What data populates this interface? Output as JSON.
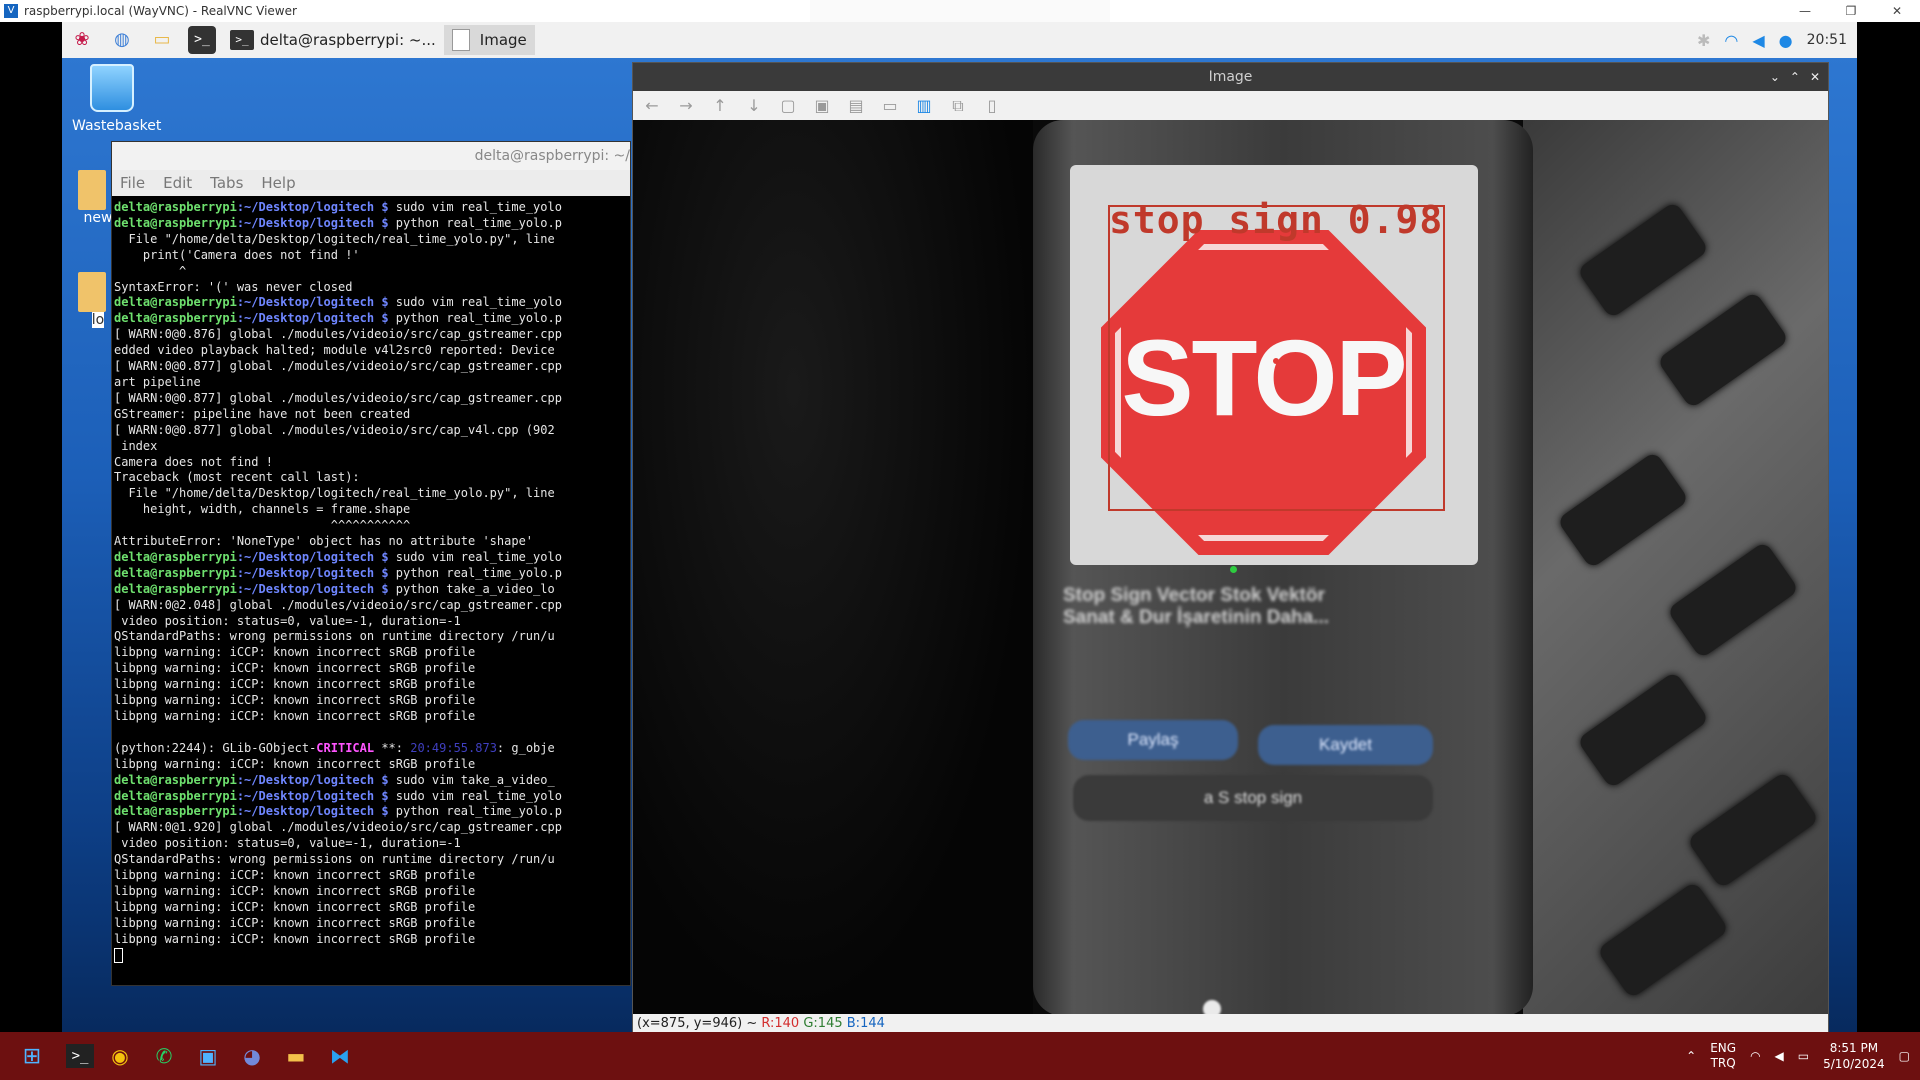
{
  "vnc": {
    "title": "raspberrypi.local (WayVNC) - RealVNC Viewer",
    "icon": "vnc-icon",
    "controls": [
      "—",
      "❐",
      "✕"
    ]
  },
  "pi_panel": {
    "tasks": [
      {
        "label": "delta@raspberrypi: ~..."
      },
      {
        "label": "Image"
      }
    ],
    "clock": "20:51"
  },
  "desktop": {
    "wastebasket": "Wastebasket",
    "folder1_label": "new",
    "folder2_label": "lo"
  },
  "terminal": {
    "title": "delta@raspberrypi: ~/",
    "menu": [
      "File",
      "Edit",
      "Tabs",
      "Help"
    ],
    "lines": [
      {
        "user": "delta@raspberrypi",
        "path": ":~/Desktop/logitech $",
        "cmd": " sudo vim real_time_yolo"
      },
      {
        "user": "delta@raspberrypi",
        "path": ":~/Desktop/logitech $",
        "cmd": " python real_time_yolo.p"
      },
      {
        "text": "  File \"/home/delta/Desktop/logitech/real_time_yolo.py\", line"
      },
      {
        "text": "    print('Camera does not find !'"
      },
      {
        "text": "         ^"
      },
      {
        "text": "SyntaxError: '(' was never closed"
      },
      {
        "user": "delta@raspberrypi",
        "path": ":~/Desktop/logitech $",
        "cmd": " sudo vim real_time_yolo"
      },
      {
        "user": "delta@raspberrypi",
        "path": ":~/Desktop/logitech $",
        "cmd": " python real_time_yolo.p"
      },
      {
        "text": "[ WARN:0@0.876] global ./modules/videoio/src/cap_gstreamer.cpp"
      },
      {
        "text": "edded video playback halted; module v4l2src0 reported: Device"
      },
      {
        "text": "[ WARN:0@0.877] global ./modules/videoio/src/cap_gstreamer.cpp"
      },
      {
        "text": "art pipeline"
      },
      {
        "text": "[ WARN:0@0.877] global ./modules/videoio/src/cap_gstreamer.cpp"
      },
      {
        "text": "GStreamer: pipeline have not been created"
      },
      {
        "text": "[ WARN:0@0.877] global ./modules/videoio/src/cap_v4l.cpp (902"
      },
      {
        "text": " index"
      },
      {
        "text": "Camera does not find !"
      },
      {
        "text": "Traceback (most recent call last):"
      },
      {
        "text": "  File \"/home/delta/Desktop/logitech/real_time_yolo.py\", line"
      },
      {
        "text": "    height, width, channels = frame.shape"
      },
      {
        "text": "                              ^^^^^^^^^^^"
      },
      {
        "text": "AttributeError: 'NoneType' object has no attribute 'shape'"
      },
      {
        "user": "delta@raspberrypi",
        "path": ":~/Desktop/logitech $",
        "cmd": " sudo vim real_time_yolo"
      },
      {
        "user": "delta@raspberrypi",
        "path": ":~/Desktop/logitech $",
        "cmd": " python real_time_yolo.p"
      },
      {
        "user": "delta@raspberrypi",
        "path": ":~/Desktop/logitech $",
        "cmd": " python take_a_video_lo"
      },
      {
        "text": "[ WARN:0@2.048] global ./modules/videoio/src/cap_gstreamer.cpp"
      },
      {
        "text": " video position: status=0, value=-1, duration=-1"
      },
      {
        "text": "QStandardPaths: wrong permissions on runtime directory /run/u"
      },
      {
        "text": "libpng warning: iCCP: known incorrect sRGB profile"
      },
      {
        "text": "libpng warning: iCCP: known incorrect sRGB profile"
      },
      {
        "text": "libpng warning: iCCP: known incorrect sRGB profile"
      },
      {
        "text": "libpng warning: iCCP: known incorrect sRGB profile"
      },
      {
        "text": "libpng warning: iCCP: known incorrect sRGB profile"
      },
      {
        "text": ""
      },
      {
        "crit_pre": "(python:2244): GLib-GObject-",
        "crit": "CRITICAL",
        "crit_mid": " **: ",
        "crit_ts": "20:49:55.873",
        "crit_post": ": g_obje"
      },
      {
        "text": "libpng warning: iCCP: known incorrect sRGB profile"
      },
      {
        "user": "delta@raspberrypi",
        "path": ":~/Desktop/logitech $",
        "cmd": " sudo vim take_a_video_"
      },
      {
        "user": "delta@raspberrypi",
        "path": ":~/Desktop/logitech $",
        "cmd": " sudo vim real_time_yolo"
      },
      {
        "user": "delta@raspberrypi",
        "path": ":~/Desktop/logitech $",
        "cmd": " python real_time_yolo.p"
      },
      {
        "text": "[ WARN:0@1.920] global ./modules/videoio/src/cap_gstreamer.cpp"
      },
      {
        "text": " video position: status=0, value=-1, duration=-1"
      },
      {
        "text": "QStandardPaths: wrong permissions on runtime directory /run/u"
      },
      {
        "text": "libpng warning: iCCP: known incorrect sRGB profile"
      },
      {
        "text": "libpng warning: iCCP: known incorrect sRGB profile"
      },
      {
        "text": "libpng warning: iCCP: known incorrect sRGB profile"
      },
      {
        "text": "libpng warning: iCCP: known incorrect sRGB profile"
      },
      {
        "text": "libpng warning: iCCP: known incorrect sRGB profile"
      }
    ]
  },
  "viewer": {
    "title": "Image",
    "toolbar_icons": [
      "arrow-left-icon",
      "arrow-right-icon",
      "arrow-up-icon",
      "arrow-down-icon",
      "zoom-fit-icon",
      "zoom-region-icon",
      "save-icon",
      "zoom-out-icon",
      "zoom-active-icon",
      "copy-icon",
      "blank-icon"
    ],
    "detection_label": "stop sign 0.98",
    "sign_text": "STOP",
    "phone_headline": "Stop Sign Vector Stok Vektör Sanat & Dur İşaretinin Daha...",
    "phone_btn_1": "Paylaş",
    "phone_btn_2": "Kaydet",
    "phone_search": "a S stop sign",
    "status_pos": "(x=875, y=946) ~ ",
    "status_r": "R:140",
    "status_g": "G:145",
    "status_b": "B:144",
    "det_color": "#c0392b"
  },
  "win_taskbar": {
    "lang_1": "ENG",
    "lang_2": "TRQ",
    "time": "8:51 PM",
    "date": "5/10/2024",
    "apps": [
      "windows-start-icon",
      "terminal-app-icon",
      "chrome-app-icon",
      "whatsapp-app-icon",
      "realvnc-app-icon",
      "discord-app-icon",
      "file-explorer-app-icon",
      "vscode-app-icon"
    ]
  }
}
